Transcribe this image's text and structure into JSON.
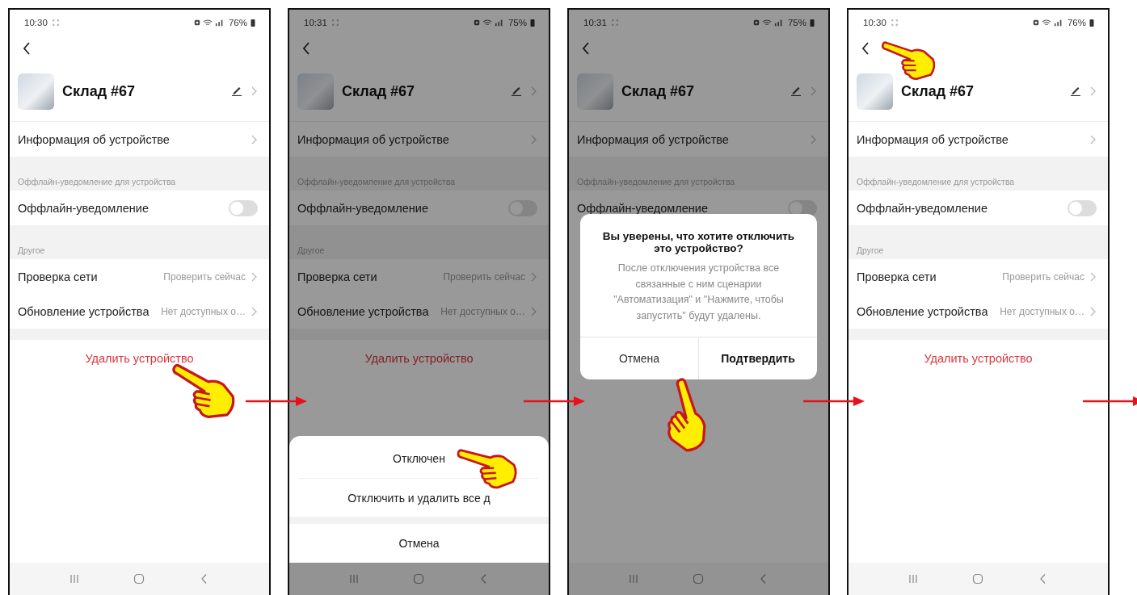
{
  "screens": [
    {
      "status": {
        "time": "10:30",
        "battery": "76%"
      },
      "dimmed": false,
      "title": "Склад #67",
      "pointer": {
        "kind": "delete"
      },
      "items": [
        {
          "kind": "link",
          "label": "Информация об устройстве"
        },
        {
          "kind": "section",
          "label": "Оффлайн-уведомление для устройства"
        },
        {
          "kind": "toggle",
          "label": "Оффлайн-уведомление",
          "on": false
        },
        {
          "kind": "section",
          "label": "Другое"
        },
        {
          "kind": "link",
          "label": "Проверка сети",
          "value": "Проверить сейчас"
        },
        {
          "kind": "link",
          "label": "Обновление устройства",
          "value": "Нет доступных о…"
        },
        {
          "kind": "danger",
          "label": "Удалить устройство"
        }
      ]
    },
    {
      "status": {
        "time": "10:31",
        "battery": "75%"
      },
      "dimmed": true,
      "title": "Склад #67",
      "pointer": {
        "kind": "sheet"
      },
      "items": [
        {
          "kind": "link",
          "label": "Информация об устройстве"
        },
        {
          "kind": "section",
          "label": "Оффлайн-уведомление для устройства"
        },
        {
          "kind": "toggle",
          "label": "Оффлайн-уведомление",
          "on": false
        },
        {
          "kind": "section",
          "label": "Другое"
        },
        {
          "kind": "link",
          "label": "Проверка сети",
          "value": "Проверить сейчас"
        },
        {
          "kind": "link",
          "label": "Обновление устройства",
          "value": "Нет доступных о…"
        },
        {
          "kind": "danger",
          "label": "Удалить устройство"
        }
      ],
      "sheet": {
        "items": [
          "Отключен",
          "Отключить и удалить все д"
        ],
        "cancel": "Отмена"
      }
    },
    {
      "status": {
        "time": "10:31",
        "battery": "75%"
      },
      "dimmed": true,
      "title": "Склад #67",
      "pointer": {
        "kind": "dialog"
      },
      "items": [
        {
          "kind": "link",
          "label": "Информация об устройстве"
        },
        {
          "kind": "section",
          "label": "Оффлайн-уведомление для устройства"
        },
        {
          "kind": "toggle",
          "label": "Оффлайн-уведомление",
          "on": false
        }
      ],
      "dialog": {
        "title": "Вы уверены, что хотите отключить это устройство?",
        "message": "После отключения устройства все связанные с ним сценарии \"Автоматизация\" и \"Нажмите, чтобы запустить\" будут удалены.",
        "buttons": [
          {
            "label": "Отмена",
            "primary": false
          },
          {
            "label": "Подтвердить",
            "primary": true
          }
        ]
      }
    },
    {
      "status": {
        "time": "10:30",
        "battery": "76%"
      },
      "dimmed": false,
      "title": "Склад #67",
      "pointer": {
        "kind": "back"
      },
      "items": [
        {
          "kind": "link",
          "label": "Информация об устройстве"
        },
        {
          "kind": "section",
          "label": "Оффлайн-уведомление для устройства"
        },
        {
          "kind": "toggle",
          "label": "Оффлайн-уведомление",
          "on": false
        },
        {
          "kind": "section",
          "label": "Другое"
        },
        {
          "kind": "link",
          "label": "Проверка сети",
          "value": "Проверить сейчас"
        },
        {
          "kind": "link",
          "label": "Обновление устройства",
          "value": "Нет доступных о…"
        },
        {
          "kind": "danger",
          "label": "Удалить устройство"
        }
      ]
    }
  ]
}
